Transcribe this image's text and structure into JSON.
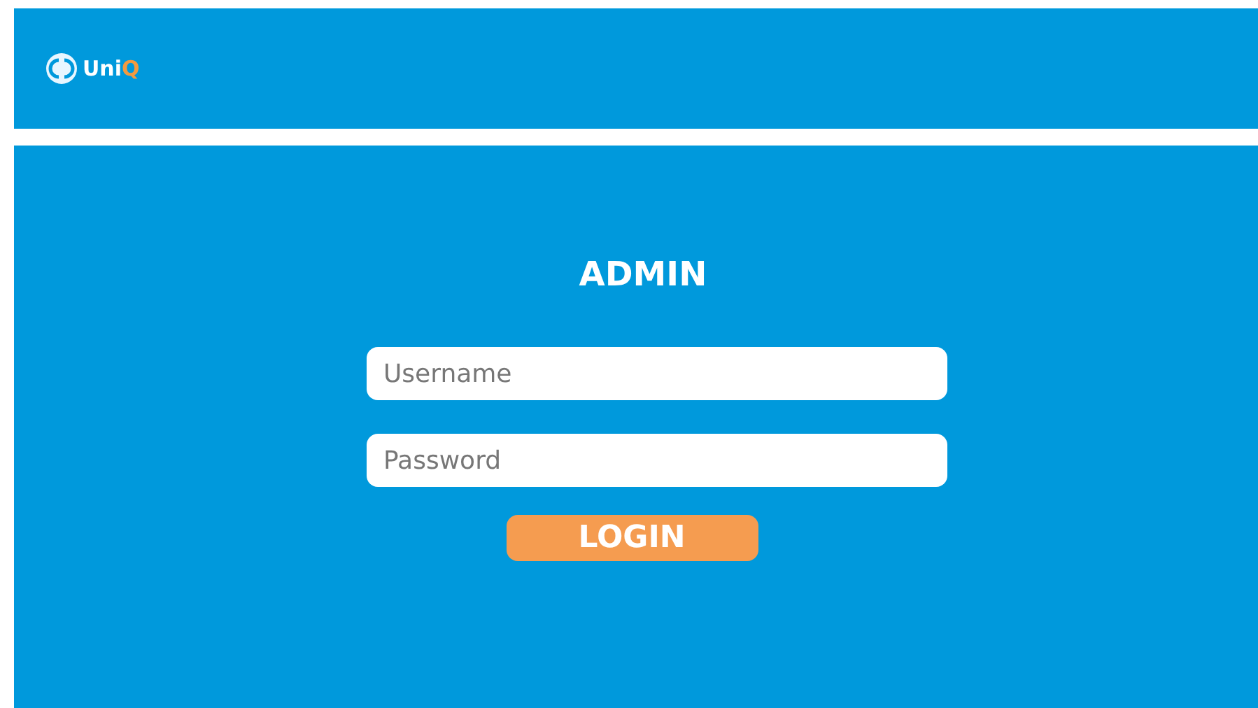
{
  "header": {
    "logo": {
      "name": "Uni",
      "accent": "Q"
    }
  },
  "login": {
    "title": "ADMIN",
    "fields": [
      {
        "placeholder": "Username"
      },
      {
        "placeholder": "Password"
      }
    ],
    "button": "LOGIN"
  }
}
